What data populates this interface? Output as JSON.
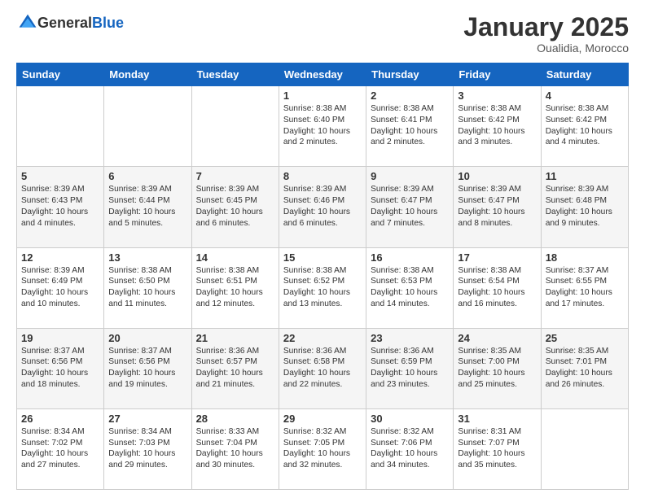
{
  "header": {
    "logo_general": "General",
    "logo_blue": "Blue",
    "month_title": "January 2025",
    "location": "Oualidia, Morocco"
  },
  "weekdays": [
    "Sunday",
    "Monday",
    "Tuesday",
    "Wednesday",
    "Thursday",
    "Friday",
    "Saturday"
  ],
  "weeks": [
    [
      {
        "day": "",
        "info": ""
      },
      {
        "day": "",
        "info": ""
      },
      {
        "day": "",
        "info": ""
      },
      {
        "day": "1",
        "info": "Sunrise: 8:38 AM\nSunset: 6:40 PM\nDaylight: 10 hours\nand 2 minutes."
      },
      {
        "day": "2",
        "info": "Sunrise: 8:38 AM\nSunset: 6:41 PM\nDaylight: 10 hours\nand 2 minutes."
      },
      {
        "day": "3",
        "info": "Sunrise: 8:38 AM\nSunset: 6:42 PM\nDaylight: 10 hours\nand 3 minutes."
      },
      {
        "day": "4",
        "info": "Sunrise: 8:38 AM\nSunset: 6:42 PM\nDaylight: 10 hours\nand 4 minutes."
      }
    ],
    [
      {
        "day": "5",
        "info": "Sunrise: 8:39 AM\nSunset: 6:43 PM\nDaylight: 10 hours\nand 4 minutes."
      },
      {
        "day": "6",
        "info": "Sunrise: 8:39 AM\nSunset: 6:44 PM\nDaylight: 10 hours\nand 5 minutes."
      },
      {
        "day": "7",
        "info": "Sunrise: 8:39 AM\nSunset: 6:45 PM\nDaylight: 10 hours\nand 6 minutes."
      },
      {
        "day": "8",
        "info": "Sunrise: 8:39 AM\nSunset: 6:46 PM\nDaylight: 10 hours\nand 6 minutes."
      },
      {
        "day": "9",
        "info": "Sunrise: 8:39 AM\nSunset: 6:47 PM\nDaylight: 10 hours\nand 7 minutes."
      },
      {
        "day": "10",
        "info": "Sunrise: 8:39 AM\nSunset: 6:47 PM\nDaylight: 10 hours\nand 8 minutes."
      },
      {
        "day": "11",
        "info": "Sunrise: 8:39 AM\nSunset: 6:48 PM\nDaylight: 10 hours\nand 9 minutes."
      }
    ],
    [
      {
        "day": "12",
        "info": "Sunrise: 8:39 AM\nSunset: 6:49 PM\nDaylight: 10 hours\nand 10 minutes."
      },
      {
        "day": "13",
        "info": "Sunrise: 8:38 AM\nSunset: 6:50 PM\nDaylight: 10 hours\nand 11 minutes."
      },
      {
        "day": "14",
        "info": "Sunrise: 8:38 AM\nSunset: 6:51 PM\nDaylight: 10 hours\nand 12 minutes."
      },
      {
        "day": "15",
        "info": "Sunrise: 8:38 AM\nSunset: 6:52 PM\nDaylight: 10 hours\nand 13 minutes."
      },
      {
        "day": "16",
        "info": "Sunrise: 8:38 AM\nSunset: 6:53 PM\nDaylight: 10 hours\nand 14 minutes."
      },
      {
        "day": "17",
        "info": "Sunrise: 8:38 AM\nSunset: 6:54 PM\nDaylight: 10 hours\nand 16 minutes."
      },
      {
        "day": "18",
        "info": "Sunrise: 8:37 AM\nSunset: 6:55 PM\nDaylight: 10 hours\nand 17 minutes."
      }
    ],
    [
      {
        "day": "19",
        "info": "Sunrise: 8:37 AM\nSunset: 6:56 PM\nDaylight: 10 hours\nand 18 minutes."
      },
      {
        "day": "20",
        "info": "Sunrise: 8:37 AM\nSunset: 6:56 PM\nDaylight: 10 hours\nand 19 minutes."
      },
      {
        "day": "21",
        "info": "Sunrise: 8:36 AM\nSunset: 6:57 PM\nDaylight: 10 hours\nand 21 minutes."
      },
      {
        "day": "22",
        "info": "Sunrise: 8:36 AM\nSunset: 6:58 PM\nDaylight: 10 hours\nand 22 minutes."
      },
      {
        "day": "23",
        "info": "Sunrise: 8:36 AM\nSunset: 6:59 PM\nDaylight: 10 hours\nand 23 minutes."
      },
      {
        "day": "24",
        "info": "Sunrise: 8:35 AM\nSunset: 7:00 PM\nDaylight: 10 hours\nand 25 minutes."
      },
      {
        "day": "25",
        "info": "Sunrise: 8:35 AM\nSunset: 7:01 PM\nDaylight: 10 hours\nand 26 minutes."
      }
    ],
    [
      {
        "day": "26",
        "info": "Sunrise: 8:34 AM\nSunset: 7:02 PM\nDaylight: 10 hours\nand 27 minutes."
      },
      {
        "day": "27",
        "info": "Sunrise: 8:34 AM\nSunset: 7:03 PM\nDaylight: 10 hours\nand 29 minutes."
      },
      {
        "day": "28",
        "info": "Sunrise: 8:33 AM\nSunset: 7:04 PM\nDaylight: 10 hours\nand 30 minutes."
      },
      {
        "day": "29",
        "info": "Sunrise: 8:32 AM\nSunset: 7:05 PM\nDaylight: 10 hours\nand 32 minutes."
      },
      {
        "day": "30",
        "info": "Sunrise: 8:32 AM\nSunset: 7:06 PM\nDaylight: 10 hours\nand 34 minutes."
      },
      {
        "day": "31",
        "info": "Sunrise: 8:31 AM\nSunset: 7:07 PM\nDaylight: 10 hours\nand 35 minutes."
      },
      {
        "day": "",
        "info": ""
      }
    ]
  ]
}
